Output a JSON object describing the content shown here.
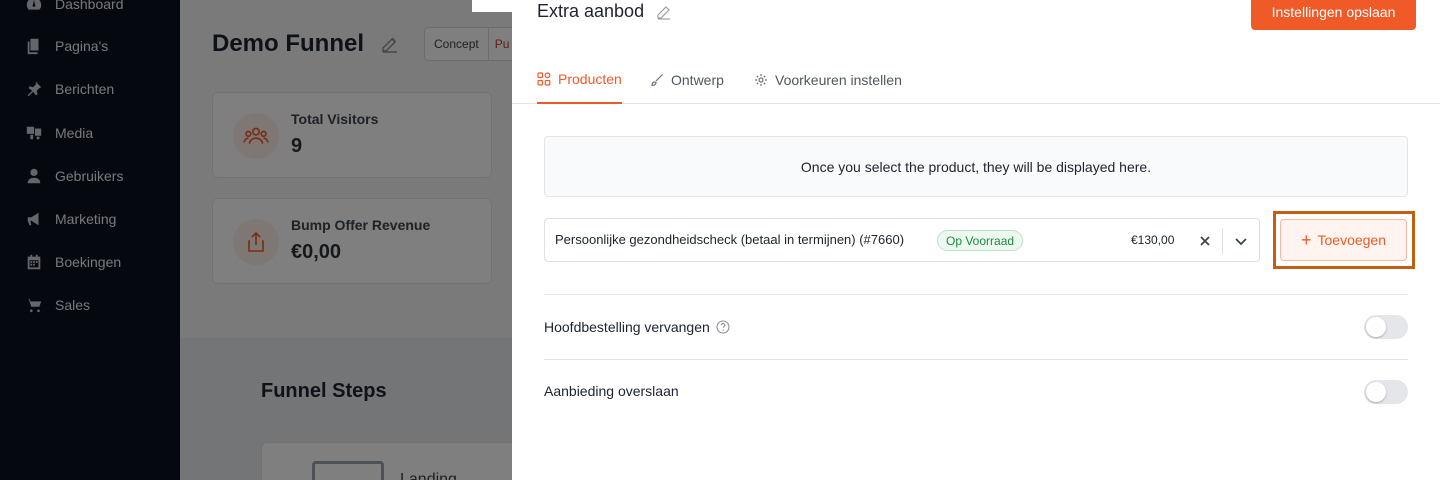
{
  "sidebar": {
    "items": [
      {
        "label": "Dashboard",
        "icon": "dashboard-icon"
      },
      {
        "label": "Pagina's",
        "icon": "pages-icon"
      },
      {
        "label": "Berichten",
        "icon": "pin-icon"
      },
      {
        "label": "Media",
        "icon": "media-icon"
      },
      {
        "label": "Gebruikers",
        "icon": "user-icon"
      },
      {
        "label": "Marketing",
        "icon": "megaphone-icon"
      },
      {
        "label": "Boekingen",
        "icon": "calendar-icon"
      },
      {
        "label": "Sales",
        "icon": "cart-icon"
      }
    ]
  },
  "background": {
    "title": "Demo Funnel",
    "status": {
      "draft": "Concept",
      "publish": "Pu"
    },
    "stats": [
      {
        "label": "Total Visitors",
        "value": "9"
      },
      {
        "label": "Bump Offer Revenue",
        "value": "€0,00"
      }
    ],
    "steps_title": "Funnel Steps",
    "step_name": "Landing"
  },
  "drawer": {
    "title": "Extra aanbod",
    "save_label": "Instellingen opslaan",
    "tabs": [
      {
        "label": "Producten",
        "active": true
      },
      {
        "label": "Ontwerp",
        "active": false
      },
      {
        "label": "Voorkeuren instellen",
        "active": false
      }
    ],
    "empty_message": "Once you select the product, they will be displayed here.",
    "product": {
      "name": "Persoonlijke gezondheidscheck (betaal in termijnen) (#7660)",
      "stock_badge": "Op Voorraad",
      "price": "€130,00"
    },
    "add_label": "Toevoegen",
    "options": [
      {
        "label": "Hoofdbestelling vervangen",
        "enabled": false,
        "has_help": true
      },
      {
        "label": "Aanbieding overslaan",
        "enabled": false,
        "has_help": false
      }
    ]
  },
  "colors": {
    "accent": "#f05a28",
    "highlight_border": "#c3600f",
    "sidebar_bg": "#0d1021",
    "badge_green": "#1e8a3d"
  }
}
